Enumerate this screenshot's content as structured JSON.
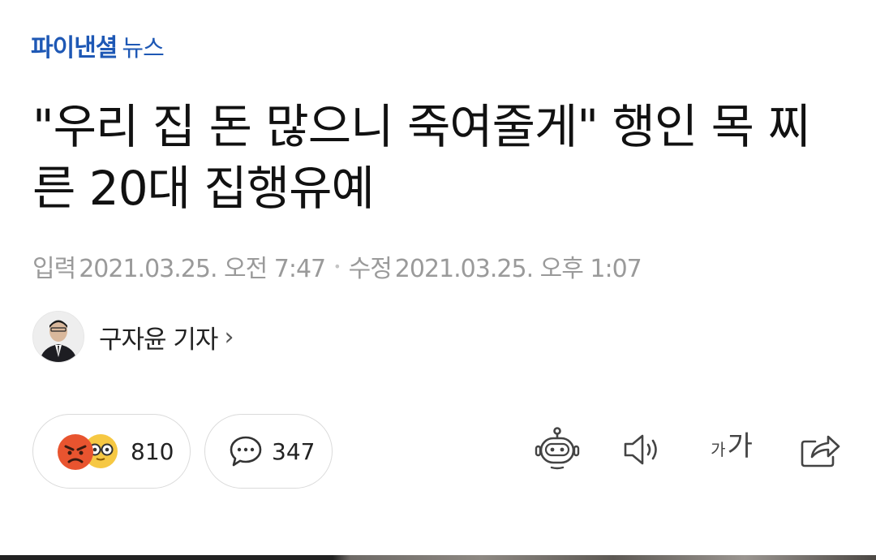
{
  "masthead": {
    "brand_main": "파이낸셜",
    "brand_sub": "뉴스"
  },
  "article": {
    "headline": "\"우리 집 돈 많으니 죽여줄게\" 행인 목 찌른 20대 집행유예",
    "input_label": "입력",
    "input_time": "2021.03.25. 오전 7:47",
    "update_label": "수정",
    "update_time": "2021.03.25. 오후 1:07",
    "separator": "•"
  },
  "author": {
    "name": "구자윤 기자",
    "chevron": "›"
  },
  "reactions": {
    "count": "810",
    "emoji_icons": [
      "angry-face-icon",
      "glasses-face-icon"
    ]
  },
  "comments": {
    "count": "347",
    "icon": "comment-bubble-icon"
  },
  "toolbar": {
    "summary_icon": "robot-icon",
    "audio_icon": "speaker-icon",
    "font_small": "가",
    "font_big": "가",
    "share_icon": "share-icon"
  },
  "colors": {
    "brand": "#1e58b5",
    "meta_text": "#9a9a9a",
    "angry_face": "#e8542f",
    "glasses_face": "#f6c843"
  }
}
